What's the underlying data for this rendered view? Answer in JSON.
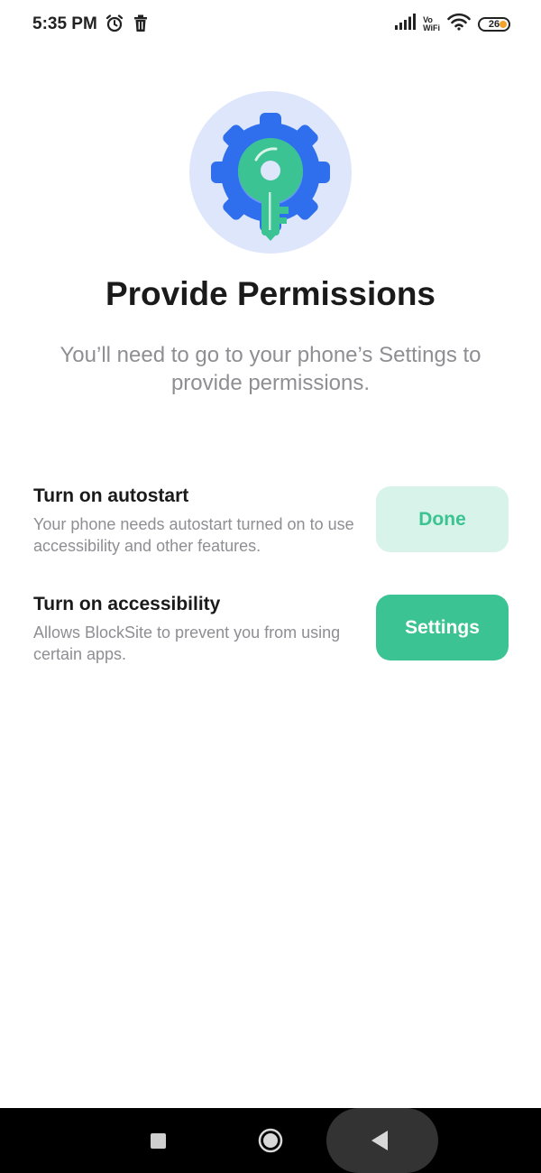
{
  "status_bar": {
    "time": "5:35 PM",
    "vo": "Vo",
    "wifi_label": "WiFi",
    "battery_level": "26"
  },
  "hero": {
    "icon": "gear-key-icon",
    "colors": {
      "circle_bg": "#dde6fb",
      "gear": "#2f6fee",
      "key": "#3cc393"
    }
  },
  "page": {
    "title": "Provide Permissions",
    "subtitle": "You’ll need to go to your phone’s Settings to provide permissions."
  },
  "permissions": [
    {
      "title": "Turn on autostart",
      "description": "Your phone needs autostart turned on to use accessibility and other features.",
      "button_label": "Done",
      "state": "done"
    },
    {
      "title": "Turn on accessibility",
      "description": "Allows BlockSite to prevent you from using certain apps.",
      "button_label": "Settings",
      "state": "pending"
    }
  ],
  "colors": {
    "accent": "#3cc393",
    "accent_light": "#d7f3ea",
    "muted_text": "#8e8e93"
  },
  "nav_bar": {
    "icons": [
      "recents-square-icon",
      "home-circle-icon",
      "back-triangle-icon"
    ]
  }
}
